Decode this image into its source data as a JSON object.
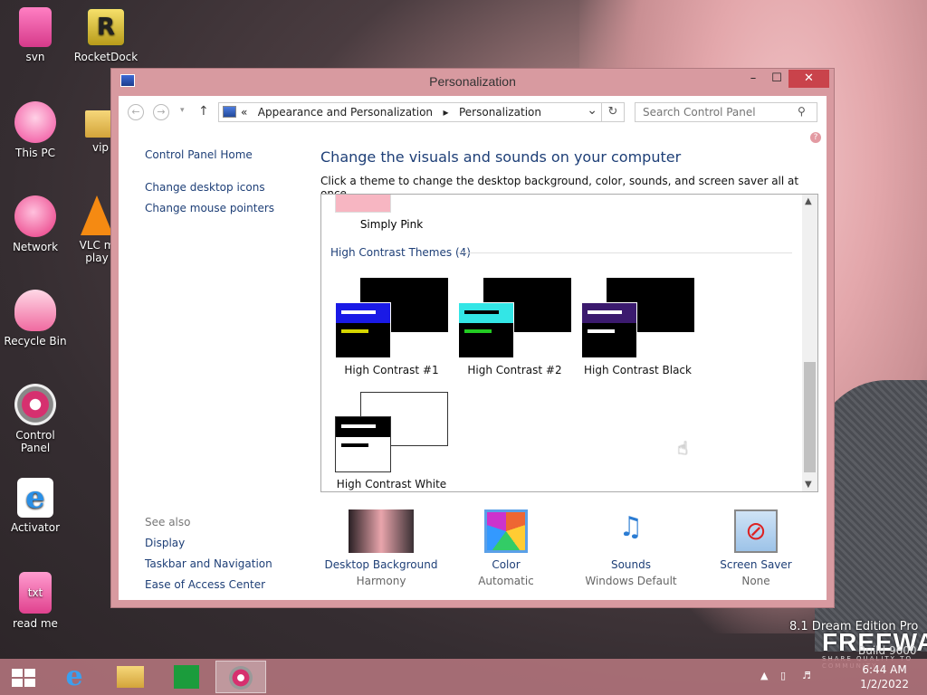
{
  "desktop": {
    "icons": [
      {
        "label": "svn",
        "icon": "svn-icon"
      },
      {
        "label": "RocketDock",
        "icon": "rocketdock-icon"
      },
      {
        "label": "This PC",
        "icon": "this-pc-icon"
      },
      {
        "label": "vip",
        "icon": "folder-icon"
      },
      {
        "label": "Network",
        "icon": "network-icon"
      },
      {
        "label": "VLC m",
        "label2": "play",
        "icon": "vlc-icon"
      },
      {
        "label": "Recycle Bin",
        "icon": "recycle-bin-icon"
      },
      {
        "label": "Control Panel",
        "icon": "control-panel-icon"
      },
      {
        "label": "Activator",
        "icon": "internet-explorer-icon"
      },
      {
        "label": "read me",
        "icon": "text-file-icon"
      }
    ],
    "watermark": {
      "line1": "8.1 Dream Edition Pro",
      "brand": "FREEWARE",
      "tag": "SHARE QUALITY TO COMMUNITY",
      "build": "Build 9600"
    }
  },
  "window": {
    "title": "Personalization",
    "controls": {
      "minimize": "–",
      "maximize": "☐",
      "close": "✕"
    }
  },
  "address": {
    "prefix": "«",
    "crumb1": "Appearance and Personalization",
    "sep": "▸",
    "crumb2": "Personalization",
    "dropdown": "⌄",
    "refresh": "↻",
    "search_placeholder": "Search Control Panel"
  },
  "nav": {
    "back": "←",
    "forward": "→",
    "recent": "▾",
    "up": "↑"
  },
  "left_panel": {
    "home": "Control Panel Home",
    "links": [
      "Change desktop icons",
      "Change mouse pointers"
    ],
    "see_also_title": "See also",
    "see_also": [
      "Display",
      "Taskbar and Navigation",
      "Ease of Access Center"
    ]
  },
  "main": {
    "heading": "Change the visuals and sounds on your computer",
    "subtext": "Click a theme to change the desktop background, color, sounds, and screen saver all at once.",
    "previous_theme": "Simply Pink",
    "group_title": "High Contrast Themes (4)",
    "themes": [
      {
        "name": "High Contrast #1",
        "accent": "#1a1ae6",
        "line2": "#d6d600"
      },
      {
        "name": "High Contrast #2",
        "accent": "#33e6e6",
        "line2": "#22cc22"
      },
      {
        "name": "High Contrast Black",
        "accent": "#3b1a6e",
        "line2": "#ffffff"
      },
      {
        "name": "High Contrast White",
        "accent": "#ffffff",
        "line2": "#000000"
      }
    ],
    "scroll_up": "▲",
    "scroll_down": "▼"
  },
  "settings": [
    {
      "title": "Desktop Background",
      "value": "Harmony"
    },
    {
      "title": "Color",
      "value": "Automatic"
    },
    {
      "title": "Sounds",
      "value": "Windows Default"
    },
    {
      "title": "Screen Saver",
      "value": "None"
    }
  ],
  "taskbar": {
    "time": "6:44 AM",
    "date": "1/2/2022",
    "tray_arrow": "▲"
  },
  "colors": {
    "accent_link": "#1e3f77",
    "window_frame": "#d89aa0",
    "close_button": "#c9434b"
  }
}
